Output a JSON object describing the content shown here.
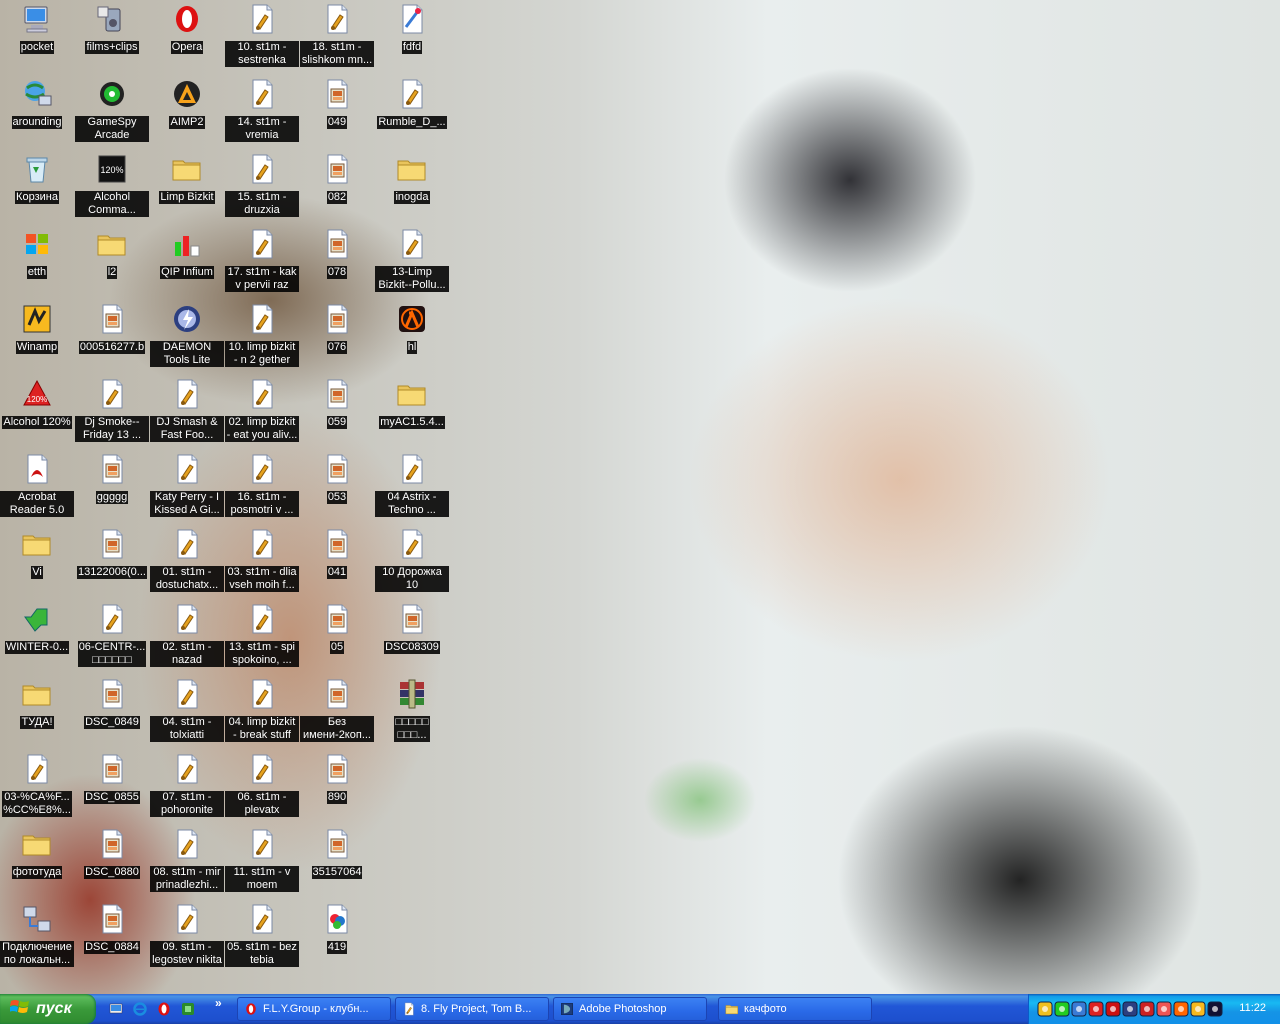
{
  "desktop": {
    "icons": [
      {
        "label": "pocket",
        "icon": "my-computer-icon",
        "name": "desktop-icon-pocket"
      },
      {
        "label": "films+clips",
        "icon": "media-device-icon",
        "name": "desktop-icon-films-clips"
      },
      {
        "label": "Opera",
        "icon": "opera-icon",
        "name": "desktop-icon-opera"
      },
      {
        "label": "10. st1m - sestrenka",
        "icon": "mp3-file-icon",
        "name": "desktop-icon-10-st1m-sestrenka"
      },
      {
        "label": "18. st1m - slishkom mn...",
        "icon": "mp3-file-icon",
        "name": "desktop-icon-18-st1m-slishkom"
      },
      {
        "label": "fdfd",
        "icon": "image-file-icon",
        "name": "desktop-icon-fdfd"
      },
      {
        "label": "arounding",
        "icon": "network-computer-icon",
        "name": "desktop-icon-arounding"
      },
      {
        "label": "GameSpy Arcade",
        "icon": "gamespy-icon",
        "name": "desktop-icon-gamespy"
      },
      {
        "label": "AIMP2",
        "icon": "aimp-icon",
        "name": "desktop-icon-aimp2"
      },
      {
        "label": "14. st1m - vremia",
        "icon": "mp3-file-icon",
        "name": "desktop-icon-14-st1m-vremia"
      },
      {
        "label": "049",
        "icon": "photoshop-file-icon",
        "name": "desktop-icon-049"
      },
      {
        "label": "Rumble_D_...",
        "icon": "mp3-file-icon",
        "name": "desktop-icon-rumble"
      },
      {
        "label": "Корзина",
        "icon": "recycle-bin-icon",
        "name": "desktop-icon-recycle-bin"
      },
      {
        "label": "Alcohol Comma...",
        "icon": "alcohol-command-icon",
        "name": "desktop-icon-alcohol-command"
      },
      {
        "label": "Limp Bizkit",
        "icon": "folder-icon",
        "name": "desktop-icon-limp-bizkit"
      },
      {
        "label": "15. st1m - druzxia",
        "icon": "mp3-file-icon",
        "name": "desktop-icon-15-st1m-druzxia"
      },
      {
        "label": "082",
        "icon": "photoshop-file-icon",
        "name": "desktop-icon-082"
      },
      {
        "label": "inogda",
        "icon": "folder-icon",
        "name": "desktop-icon-inogda"
      },
      {
        "label": "etth",
        "icon": "windows-flag-icon",
        "name": "desktop-icon-etth"
      },
      {
        "label": "l2",
        "icon": "folder-icon",
        "name": "desktop-icon-l2"
      },
      {
        "label": "QIP Infium",
        "icon": "qip-icon",
        "name": "desktop-icon-qip-infium"
      },
      {
        "label": "17. st1m - kak v pervii raz",
        "icon": "mp3-file-icon",
        "name": "desktop-icon-17-st1m-kak"
      },
      {
        "label": "078",
        "icon": "photoshop-file-icon",
        "name": "desktop-icon-078"
      },
      {
        "label": "13-Limp Bizkit--Pollu...",
        "icon": "mp3-file-icon",
        "name": "desktop-icon-13-limp-bizkit"
      },
      {
        "label": "Winamp",
        "icon": "winamp-icon",
        "name": "desktop-icon-winamp"
      },
      {
        "label": "000516277.b",
        "icon": "photoshop-file-icon",
        "name": "desktop-icon-000516277"
      },
      {
        "label": "DAEMON Tools Lite",
        "icon": "daemon-tools-icon",
        "name": "desktop-icon-daemon-tools"
      },
      {
        "label": "10. limp bizkit - n 2 gether n...",
        "icon": "mp3-file-icon",
        "name": "desktop-icon-10-limp-bizkit"
      },
      {
        "label": "076",
        "icon": "photoshop-file-icon",
        "name": "desktop-icon-076"
      },
      {
        "label": "hl",
        "icon": "half-life-icon",
        "name": "desktop-icon-hl"
      },
      {
        "label": "Alcohol 120%",
        "icon": "alcohol-120-icon",
        "name": "desktop-icon-alcohol-120"
      },
      {
        "label": "Dj Smoke--Friday 13 ...",
        "icon": "mp3-file-icon",
        "name": "desktop-icon-dj-smoke"
      },
      {
        "label": "DJ Smash & Fast Foo...",
        "icon": "mp3-file-icon",
        "name": "desktop-icon-dj-smash"
      },
      {
        "label": "02. limp bizkit - eat you aliv...",
        "icon": "mp3-file-icon",
        "name": "desktop-icon-02-limp-bizkit"
      },
      {
        "label": "059",
        "icon": "photoshop-file-icon",
        "name": "desktop-icon-059"
      },
      {
        "label": "myAC1.5.4...",
        "icon": "folder-icon",
        "name": "desktop-icon-myac"
      },
      {
        "label": "Acrobat Reader 5.0",
        "icon": "acrobat-icon",
        "name": "desktop-icon-acrobat"
      },
      {
        "label": "ggggg",
        "icon": "photoshop-file-icon",
        "name": "desktop-icon-ggggg"
      },
      {
        "label": "Katy Perry - I Kissed A Gi...",
        "icon": "mp3-file-icon",
        "name": "desktop-icon-katy-perry"
      },
      {
        "label": "16. st1m - posmotri v ...",
        "icon": "mp3-file-icon",
        "name": "desktop-icon-16-st1m-posmotri"
      },
      {
        "label": "053",
        "icon": "photoshop-file-icon",
        "name": "desktop-icon-053"
      },
      {
        "label": "04 Astrix - Techno ...",
        "icon": "mp3-file-icon",
        "name": "desktop-icon-04-astrix"
      },
      {
        "label": "Vi",
        "icon": "folder-icon",
        "name": "desktop-icon-vi"
      },
      {
        "label": "13122006(0...",
        "icon": "photoshop-file-icon",
        "name": "desktop-icon-13122006"
      },
      {
        "label": "01. st1m - dostuchatx...",
        "icon": "mp3-file-icon",
        "name": "desktop-icon-01-st1m-dostuchatx"
      },
      {
        "label": "03. st1m - dlia vseh moih f...",
        "icon": "mp3-file-icon",
        "name": "desktop-icon-03-st1m-dlia"
      },
      {
        "label": "041",
        "icon": "photoshop-file-icon",
        "name": "desktop-icon-041"
      },
      {
        "label": "10 Дорожка 10",
        "icon": "mp3-file-icon",
        "name": "desktop-icon-10-dorozhka"
      },
      {
        "label": "WINTER-0...",
        "icon": "green-arrow-icon",
        "name": "desktop-icon-winter"
      },
      {
        "label": "06-CENTR-...\n□□□□□□",
        "icon": "mp3-file-icon",
        "name": "desktop-icon-06-centr"
      },
      {
        "label": "02. st1m - nazad",
        "icon": "mp3-file-icon",
        "name": "desktop-icon-02-st1m-nazad"
      },
      {
        "label": "13. st1m - spi spokoino, ...",
        "icon": "mp3-file-icon",
        "name": "desktop-icon-13-st1m-spi"
      },
      {
        "label": "05",
        "icon": "photoshop-file-icon",
        "name": "desktop-icon-05"
      },
      {
        "label": "DSC08309",
        "icon": "photoshop-file-icon",
        "name": "desktop-icon-dsc08309"
      },
      {
        "label": "ТУДА!",
        "icon": "folder-icon",
        "name": "desktop-icon-tuda"
      },
      {
        "label": "DSC_0849",
        "icon": "photoshop-file-icon",
        "name": "desktop-icon-dsc-0849"
      },
      {
        "label": "04. st1m - tolxiatti",
        "icon": "mp3-file-icon",
        "name": "desktop-icon-04-st1m-tolxiatti"
      },
      {
        "label": "04. limp bizkit - break stuff",
        "icon": "mp3-file-icon",
        "name": "desktop-icon-04-limp-bizkit"
      },
      {
        "label": "Без имени-2коп...",
        "icon": "photoshop-file-icon",
        "name": "desktop-icon-bez-imeni"
      },
      {
        "label": "□□□□□\n□□□...",
        "icon": "winrar-icon",
        "name": "desktop-icon-rar-archive"
      },
      {
        "label": "03-%CA%F...\n%CC%E8%...",
        "icon": "mp3-file-icon",
        "name": "desktop-icon-03-ca"
      },
      {
        "label": "DSC_0855",
        "icon": "photoshop-file-icon",
        "name": "desktop-icon-dsc-0855"
      },
      {
        "label": "07. st1m - pohoronite",
        "icon": "mp3-file-icon",
        "name": "desktop-icon-07-st1m-pohoronite"
      },
      {
        "label": "06. st1m - plevatx",
        "icon": "mp3-file-icon",
        "name": "desktop-icon-06-st1m-plevatx"
      },
      {
        "label": "890",
        "icon": "photoshop-file-icon",
        "name": "desktop-icon-890"
      },
      {
        "label": "фототуда",
        "icon": "folder-icon",
        "name": "desktop-icon-fototuda"
      },
      {
        "label": "DSC_0880",
        "icon": "photoshop-file-icon",
        "name": "desktop-icon-dsc-0880"
      },
      {
        "label": "08. st1m - mir prinadlezhi...",
        "icon": "mp3-file-icon",
        "name": "desktop-icon-08-st1m-mir"
      },
      {
        "label": "11. st1m - v moem kvartale",
        "icon": "mp3-file-icon",
        "name": "desktop-icon-11-st1m-v-moem"
      },
      {
        "label": "35157064",
        "icon": "photoshop-file-icon",
        "name": "desktop-icon-35157064"
      },
      {
        "label": "Подключение по локальн...",
        "icon": "network-connection-icon",
        "name": "desktop-icon-local-connection"
      },
      {
        "label": "DSC_0884",
        "icon": "photoshop-file-icon",
        "name": "desktop-icon-dsc-0884"
      },
      {
        "label": "09. st1m - legostev nikita",
        "icon": "mp3-file-icon",
        "name": "desktop-icon-09-st1m-legostev"
      },
      {
        "label": "05. st1m - bez tebia",
        "icon": "mp3-file-icon",
        "name": "desktop-icon-05-st1m-bez-tebia"
      },
      {
        "label": "419",
        "icon": "picture-file-icon",
        "name": "desktop-icon-419"
      }
    ]
  },
  "taskbar": {
    "start_label": "пуск",
    "quick_launch": [
      {
        "icon": "show-desktop-icon",
        "name": "quick-launch-show-desktop"
      },
      {
        "icon": "internet-explorer-icon",
        "name": "quick-launch-ie"
      },
      {
        "icon": "opera-icon",
        "name": "quick-launch-opera"
      },
      {
        "icon": "green-app-icon",
        "name": "quick-launch-green-app"
      }
    ],
    "chevron": "»",
    "tasks": [
      {
        "label": "F.L.Y.Group - клубн...",
        "icon": "opera-icon",
        "name": "task-opera-fly-group",
        "active": false
      },
      {
        "label": "8. Fly Project, Tom B...",
        "icon": "mp3-file-icon",
        "name": "task-fly-project",
        "active": false
      },
      {
        "label": "Adobe Photoshop",
        "icon": "photoshop-icon",
        "name": "task-adobe-photoshop",
        "active": false
      },
      {
        "label": "качфото",
        "icon": "folder-icon",
        "name": "task-kachfoto",
        "active": false
      }
    ],
    "tray_icons": [
      "shield-icon",
      "qip-tray-icon",
      "network-icon",
      "alcohol-tray-icon",
      "ati-icon",
      "daemon-tray-icon",
      "flash-icon",
      "antivirus-icon",
      "halflife-tray-icon",
      "winamp-tray-icon",
      "aimp-tray-icon"
    ],
    "clock": "11:22"
  },
  "colors": {
    "taskbar_blue": "#245edb",
    "start_green": "#3a9a3a",
    "tray_blue": "#139ee9"
  }
}
